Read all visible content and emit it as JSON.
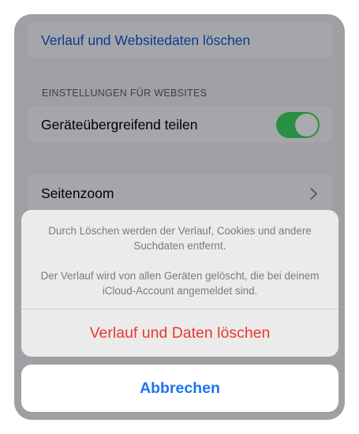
{
  "settings": {
    "clear_history_label": "Verlauf und Websitedaten löschen",
    "section_header": "EINSTELLUNGEN FÜR WEBSITES",
    "share_across_devices_label": "Geräteübergreifend teilen",
    "share_across_devices_on": true,
    "page_zoom_label": "Seitenzoom"
  },
  "action_sheet": {
    "message_line_1": "Durch Löschen werden der Verlauf, Cookies und andere Suchdaten entfernt.",
    "message_line_2": "Der Verlauf wird von allen Geräten gelöscht, die bei deinem iCloud-Account angemeldet sind.",
    "destructive_label": "Verlauf und Daten löschen",
    "cancel_label": "Abbrechen"
  },
  "colors": {
    "link_blue": "#1e74f0",
    "destructive_red": "#e8392f",
    "toggle_green": "#2a8f42"
  }
}
